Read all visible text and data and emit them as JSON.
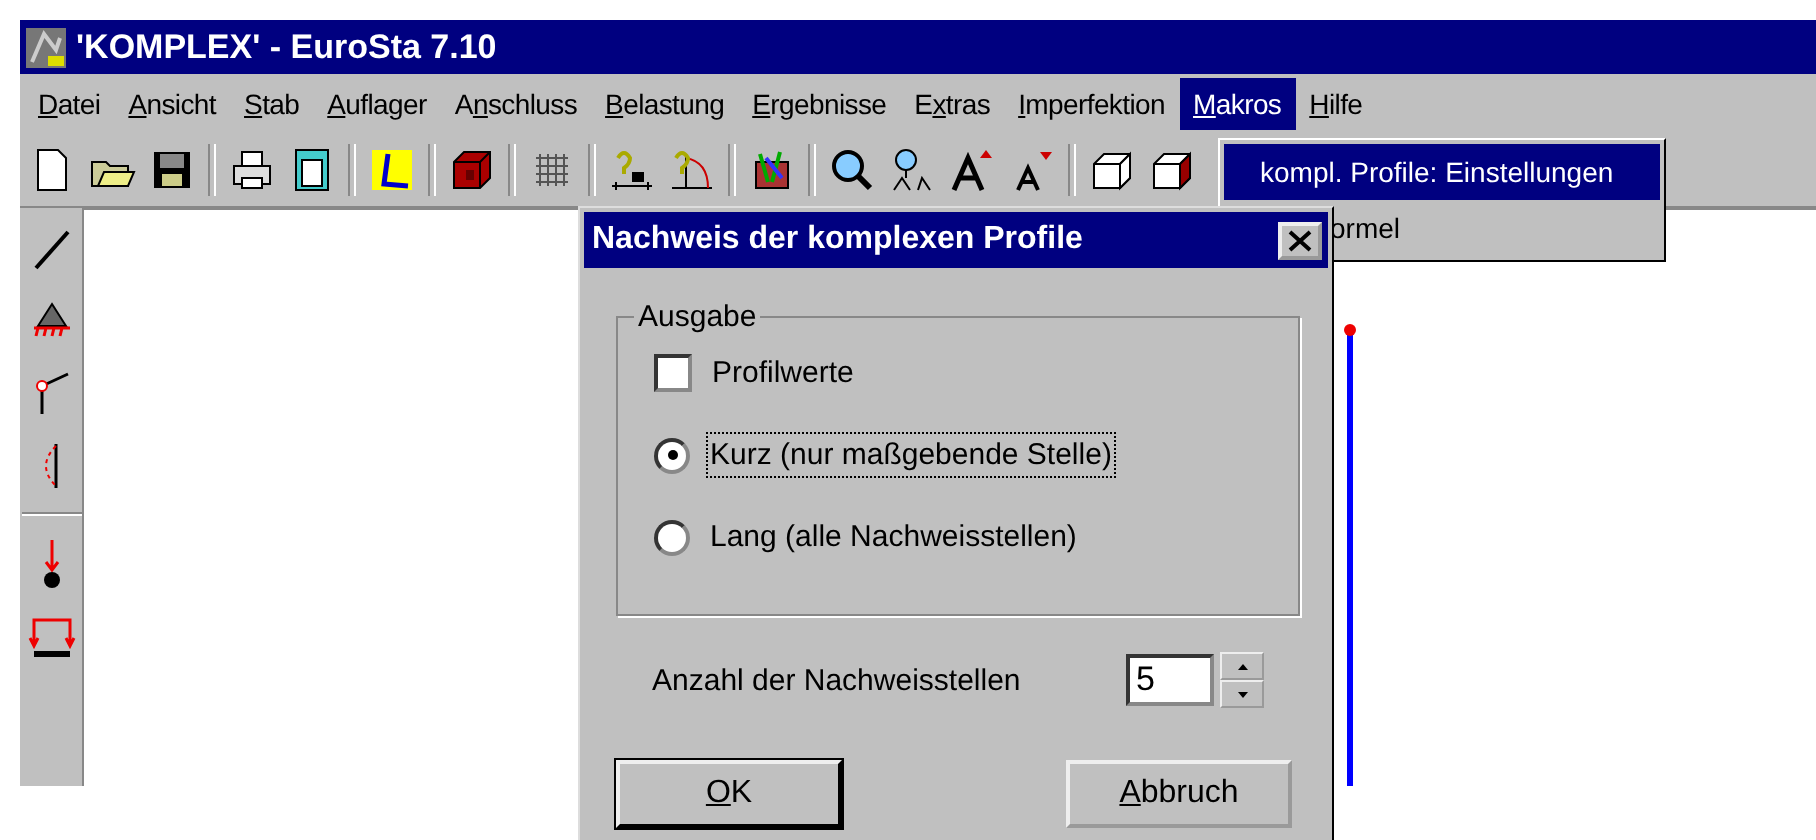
{
  "window": {
    "title": "'KOMPLEX' - EuroSta 7.10"
  },
  "menu": [
    {
      "key": "D",
      "post": "atei",
      "selected": false
    },
    {
      "key": "A",
      "post": "nsicht",
      "selected": false
    },
    {
      "key": "S",
      "post": "tab",
      "selected": false
    },
    {
      "key": "A",
      "post": "uflager",
      "selected": false
    },
    {
      "pre": "A",
      "key": "n",
      "post": "schluss",
      "selected": false
    },
    {
      "key": "B",
      "post": "elastung",
      "selected": false
    },
    {
      "key": "E",
      "post": "rgebnisse",
      "selected": false
    },
    {
      "pre": "E",
      "key": "x",
      "post": "tras",
      "selected": false
    },
    {
      "key": "I",
      "post": "mperfektion",
      "selected": false
    },
    {
      "key": "M",
      "post": "akros",
      "selected": true
    },
    {
      "key": "H",
      "post": "ilfe",
      "selected": false
    }
  ],
  "dropdown": {
    "items": [
      {
        "label": "kompl. Profile: Einstellungen",
        "selected": true
      },
      {
        "label": "ormel",
        "selected": false
      }
    ]
  },
  "dialog": {
    "title": "Nachweis der komplexen Profile",
    "group": {
      "label": "Ausgabe",
      "options": [
        {
          "kind": "checkbox",
          "label": "Profilwerte",
          "checked": false,
          "focused": false
        },
        {
          "kind": "radio",
          "label": "Kurz (nur maßgebende Stelle)",
          "selected": true,
          "focused": true
        },
        {
          "kind": "radio",
          "label": "Lang (alle Nachweisstellen)",
          "selected": false,
          "focused": false
        }
      ]
    },
    "count": {
      "label": "Anzahl der Nachweisstellen",
      "value": "5"
    },
    "buttons": [
      {
        "key": "O",
        "post": "K",
        "default": true
      },
      {
        "key": "A",
        "post": "bbruch",
        "default": false
      }
    ]
  }
}
